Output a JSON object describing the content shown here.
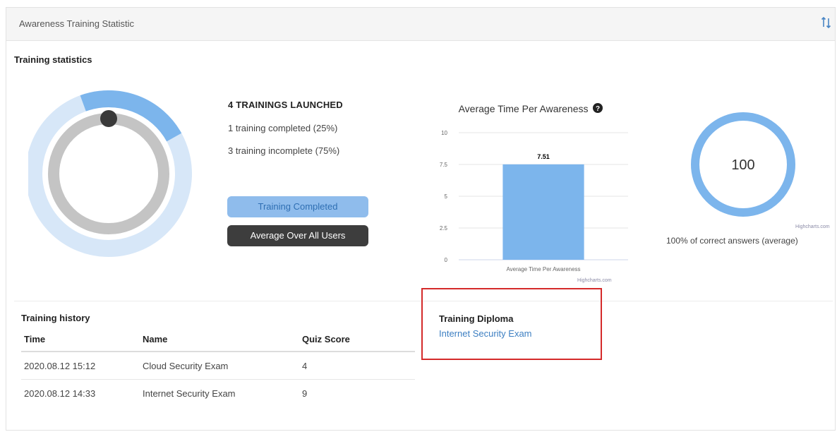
{
  "panel": {
    "title": "Awareness Training Statistic",
    "sort_icon": "sort-arrows-icon"
  },
  "stats": {
    "section_title": "Training statistics",
    "headline": "4 TRAININGS LAUNCHED",
    "completed_text": "1 training completed (25%)",
    "incomplete_text": "3 training incomplete (75%)",
    "completed_fraction": 0.25,
    "btn_completed": "Training Completed",
    "btn_average": "Average Over All Users"
  },
  "bar_chart": {
    "info_icon": "question-circle-icon",
    "credit": "Highcharts.com"
  },
  "chart_data": [
    {
      "type": "bar",
      "title": "Average Time Per Awareness",
      "categories": [
        "Average Time Per Awareness"
      ],
      "values": [
        7.51
      ],
      "data_label": "7.51",
      "ylim": [
        0,
        10
      ],
      "yticks": [
        "0",
        "2.5",
        "5",
        "7.5",
        "10"
      ],
      "grid": true,
      "color": "#7cb5ec"
    }
  ],
  "gauge": {
    "value": 100,
    "value_label": "100",
    "caption": "100% of correct answers (average)",
    "credit": "Highcharts.com",
    "color": "#7cb5ec"
  },
  "history": {
    "section_title": "Training history",
    "columns": [
      "Time",
      "Name",
      "Quiz Score"
    ],
    "rows": [
      [
        "2020.08.12 15:12",
        "Cloud Security Exam",
        "4"
      ],
      [
        "2020.08.12 14:33",
        "Internet Security Exam",
        "9"
      ]
    ]
  },
  "diploma": {
    "section_title": "Training Diploma",
    "link": "Internet Security Exam",
    "highlight_color": "#d42a2a"
  },
  "colors": {
    "ring_light": "#d7e7f8",
    "ring_accent": "#7cb5ec",
    "ring_gray": "#c4c4c4",
    "dot": "#3a3a3a"
  }
}
